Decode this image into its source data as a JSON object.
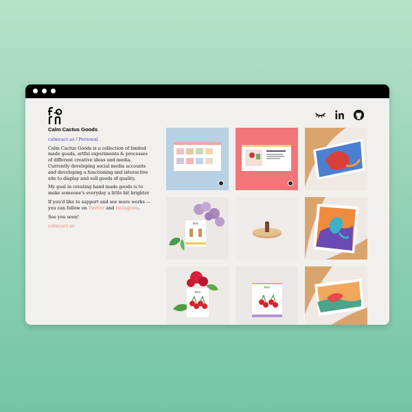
{
  "brand": {
    "logo_letters": "fern"
  },
  "social": {
    "icons": [
      "eye-lashes-icon",
      "linkedin-icon",
      "github-icon"
    ]
  },
  "project": {
    "title": "Calm Cactus Goods",
    "subtitle": "calmcact.us / Personal",
    "description_1": "Calm Cactus Goods is a collection of limited made goods, artful experiments & processes of different creative ideas and media. Currently developing social media accounts and developing a functioning and interactive site to display and sell goods of quality.",
    "description_2": "My goal in creating hand made goods is to make someone's everyday a little bit brighter",
    "follow_prefix": "If you'd like to support and see more works — you can follow on ",
    "twitter_label": "Twitter",
    "follow_and": " and ",
    "instagram_label": "Instagram",
    "follow_suffix": ".",
    "sign_off": "See you soon!",
    "site_link": "calmcact.us"
  },
  "gallery": {
    "tiles": [
      {
        "name": "website-screenshot-blue",
        "bg": "#b7d0e3"
      },
      {
        "name": "website-screenshot-coral",
        "bg": "#f2757a"
      },
      {
        "name": "art-print-octopus-red",
        "bg": "#efe9e6"
      },
      {
        "name": "earrings-lilac",
        "bg": "#ece8e6"
      },
      {
        "name": "wood-stand",
        "bg": "#efebe8"
      },
      {
        "name": "art-print-octopus-blue",
        "bg": "#efe9e6"
      },
      {
        "name": "cherry-earrings-roses",
        "bg": "#ece9e7"
      },
      {
        "name": "cherry-earrings-card",
        "bg": "#ebe7e6"
      },
      {
        "name": "art-print-octopus-green",
        "bg": "#efe9e6"
      }
    ]
  }
}
